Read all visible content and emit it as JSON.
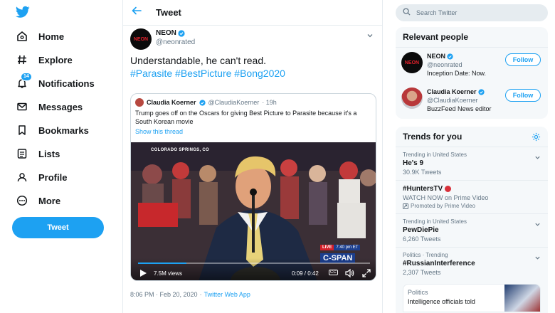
{
  "nav": {
    "items": [
      {
        "label": "Home",
        "icon": "home-icon"
      },
      {
        "label": "Explore",
        "icon": "hashtag-icon"
      },
      {
        "label": "Notifications",
        "icon": "bell-icon",
        "badge": "14"
      },
      {
        "label": "Messages",
        "icon": "envelope-icon"
      },
      {
        "label": "Bookmarks",
        "icon": "bookmark-icon"
      },
      {
        "label": "Lists",
        "icon": "list-icon"
      },
      {
        "label": "Profile",
        "icon": "profile-icon"
      },
      {
        "label": "More",
        "icon": "more-icon"
      }
    ],
    "tweet_button": "Tweet"
  },
  "header": {
    "title": "Tweet"
  },
  "tweet": {
    "author_name": "NEON",
    "author_handle": "@neonrated",
    "avatar_text": "NEON",
    "text": "Understandable, he can't read.",
    "hashtags": "#Parasite #BestPicture #Bong2020",
    "timestamp": "8:06 PM · Feb 20, 2020",
    "separator": "·",
    "source": "Twitter Web App"
  },
  "quote": {
    "author_name": "Claudia Koerner",
    "author_handle": "@ClaudiaKoerner",
    "age": "· 19h",
    "text": "Trump goes off on the Oscars for giving Best Picture to Parasite because it's a South Korean movie",
    "link": "Show this thread",
    "video": {
      "location": "COLORADO SPRINGS, CO",
      "live_label": "LIVE",
      "live_time": "7:40 pm ET",
      "network": "C-SPAN",
      "views": "7.5M views",
      "time": "0:09 / 0:42",
      "cc": "CC",
      "progress": 0.21
    }
  },
  "search": {
    "placeholder": "Search Twitter"
  },
  "relevant": {
    "title": "Relevant people",
    "people": [
      {
        "name": "NEON",
        "handle": "@neonrated",
        "bio": "Inception Date: Now.",
        "follow": "Follow"
      },
      {
        "name": "Claudia Koerner",
        "handle": "@ClaudiaKoerner",
        "bio": "BuzzFeed News editor",
        "follow": "Follow"
      }
    ]
  },
  "trends": {
    "title": "Trends for you",
    "items": [
      {
        "context": "Trending in United States",
        "name": "He's 9",
        "count": "30.9K Tweets"
      },
      {
        "context": "",
        "name": "#HuntersTV",
        "sub": "WATCH NOW on Prime Video",
        "promo": "Promoted by Prime Video"
      },
      {
        "context": "Trending in United States",
        "name": "PewDiePie",
        "count": "6,260 Tweets"
      },
      {
        "context": "Politics · Trending",
        "name": "#RussianInterference",
        "count": "2,307 Tweets"
      }
    ],
    "news": {
      "context": "Politics",
      "title": "Intelligence officials told"
    }
  },
  "colors": {
    "accent": "#1da1f2",
    "text": "#14171a",
    "muted": "#657786"
  }
}
